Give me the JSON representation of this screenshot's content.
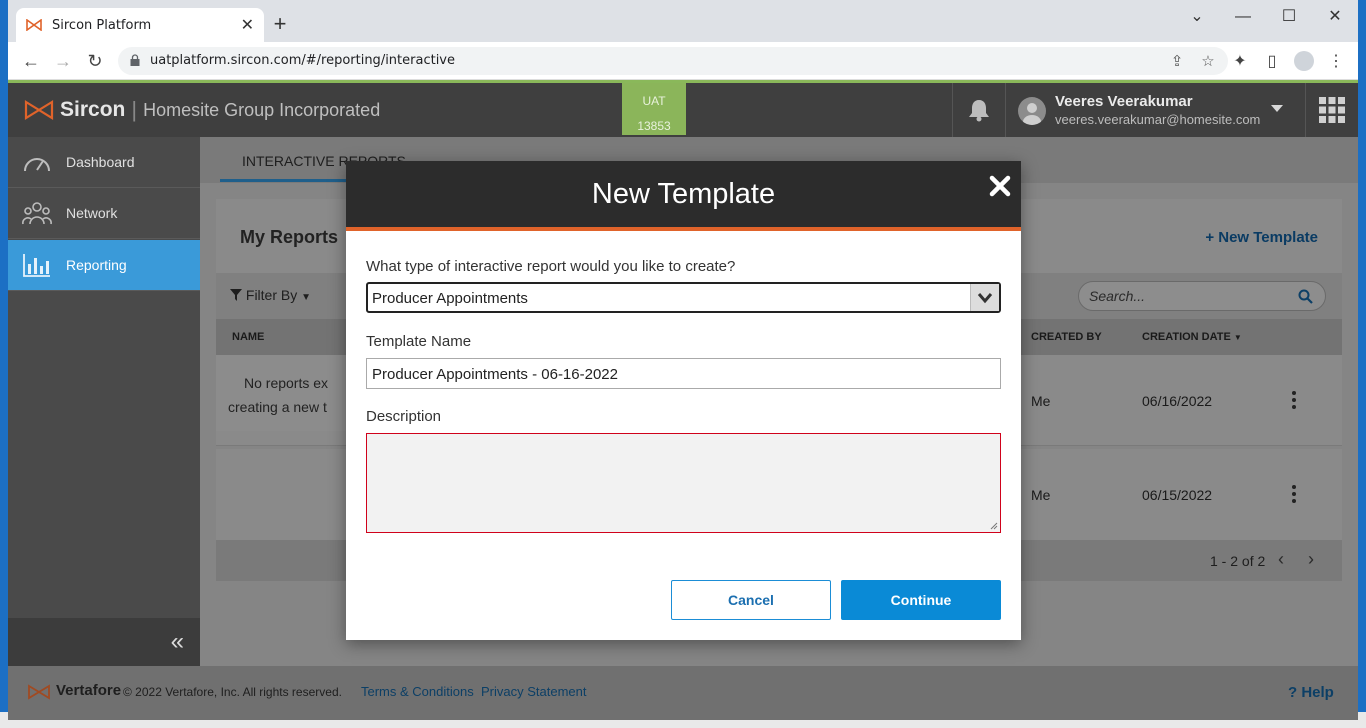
{
  "browser": {
    "tab_title": "Sircon Platform",
    "url": "uatplatform.sircon.com/#/reporting/interactive"
  },
  "header": {
    "brand": "Sircon",
    "org": "Homesite Group Incorporated",
    "env_label": "UAT",
    "env_number": "13853",
    "user_name": "Veeres Veerakumar",
    "user_email": "veeres.veerakumar@homesite.com"
  },
  "sidebar": {
    "items": [
      {
        "label": "Dashboard"
      },
      {
        "label": "Network"
      },
      {
        "label": "Reporting"
      }
    ]
  },
  "main": {
    "tab_label": "INTERACTIVE REPORTS",
    "panel_title": "My Reports",
    "new_template_label": "New Template",
    "filter_label": "Filter By",
    "search_placeholder": "Search...",
    "columns": {
      "name": "NAME",
      "created_by": "CREATED BY",
      "creation_date": "CREATION DATE"
    },
    "empty_line1": "No reports ex",
    "empty_line2": "creating a new t",
    "rows": [
      {
        "created_by": "Me",
        "date": "06/16/2022"
      },
      {
        "created_by": "Me",
        "date": "06/15/2022"
      }
    ],
    "pager": "1 - 2 of 2"
  },
  "footer": {
    "brand": "Vertafore",
    "copyright": "© 2022 Vertafore, Inc. All rights reserved.",
    "terms": "Terms & Conditions",
    "privacy": "Privacy Statement",
    "help": "Help"
  },
  "modal": {
    "title": "New Template",
    "type_question": "What type of interactive report would you like to create?",
    "type_value": "Producer Appointments",
    "name_label": "Template Name",
    "name_value": "Producer Appointments - 06-16-2022",
    "description_label": "Description",
    "cancel_label": "Cancel",
    "continue_label": "Continue"
  },
  "colors": {
    "accent_blue": "#0a8ad6",
    "sircon_orange": "#e0632a",
    "uat_green": "#8bb55a",
    "error_red": "#d0021b"
  }
}
